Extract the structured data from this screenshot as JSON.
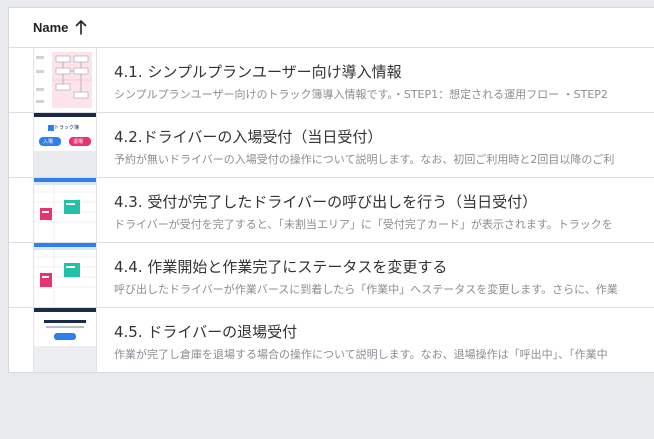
{
  "table": {
    "column_header": "Name",
    "sort_icon": "arrow-up-icon",
    "rows": [
      {
        "title": "4.1. シンプルプランユーザー向け導入情報",
        "description": "シンプルプランユーザー向けのトラック簿導入情報です。・STEP1：想定される運用フロー ・STEP2",
        "thumbnail": "flowchart-document-thumbnail"
      },
      {
        "title": "4.2.ドライバーの入場受付（当日受付）",
        "description": "予約が無いドライバーの入場受付の操作について説明します。なお、初回ご利用時と2回目以降のご利",
        "thumbnail": "entry-reception-thumbnail",
        "thumb_brand": "トラック簿",
        "thumb_buttons": [
          "入場",
          "退場"
        ]
      },
      {
        "title": "4.3. 受付が完了したドライバーの呼び出しを行う（当日受付）",
        "description": "ドライバーが受付を完了すると、「未割当エリア」に「受付完了カード」が表示されます。トラックを",
        "thumbnail": "dashboard-cards-thumbnail"
      },
      {
        "title": "4.4. 作業開始と作業完了にステータスを変更する",
        "description": "呼び出したドライバーが作業バースに到着したら「作業中」へステータスを変更します。さらに、作業",
        "thumbnail": "status-board-thumbnail"
      },
      {
        "title": "4.5. ドライバーの退場受付",
        "description": "作業が完了し倉庫を退場する場合の操作について説明します。なお、退場操作は「呼出中」、「作業中",
        "thumbnail": "exit-reception-thumbnail"
      }
    ]
  },
  "colors": {
    "background": "#e9eaee",
    "panel": "#ffffff",
    "accent_blue": "#2f80ed",
    "accent_pink": "#e8336f",
    "accent_teal": "#22c2a8",
    "navy": "#1c2a4a"
  }
}
